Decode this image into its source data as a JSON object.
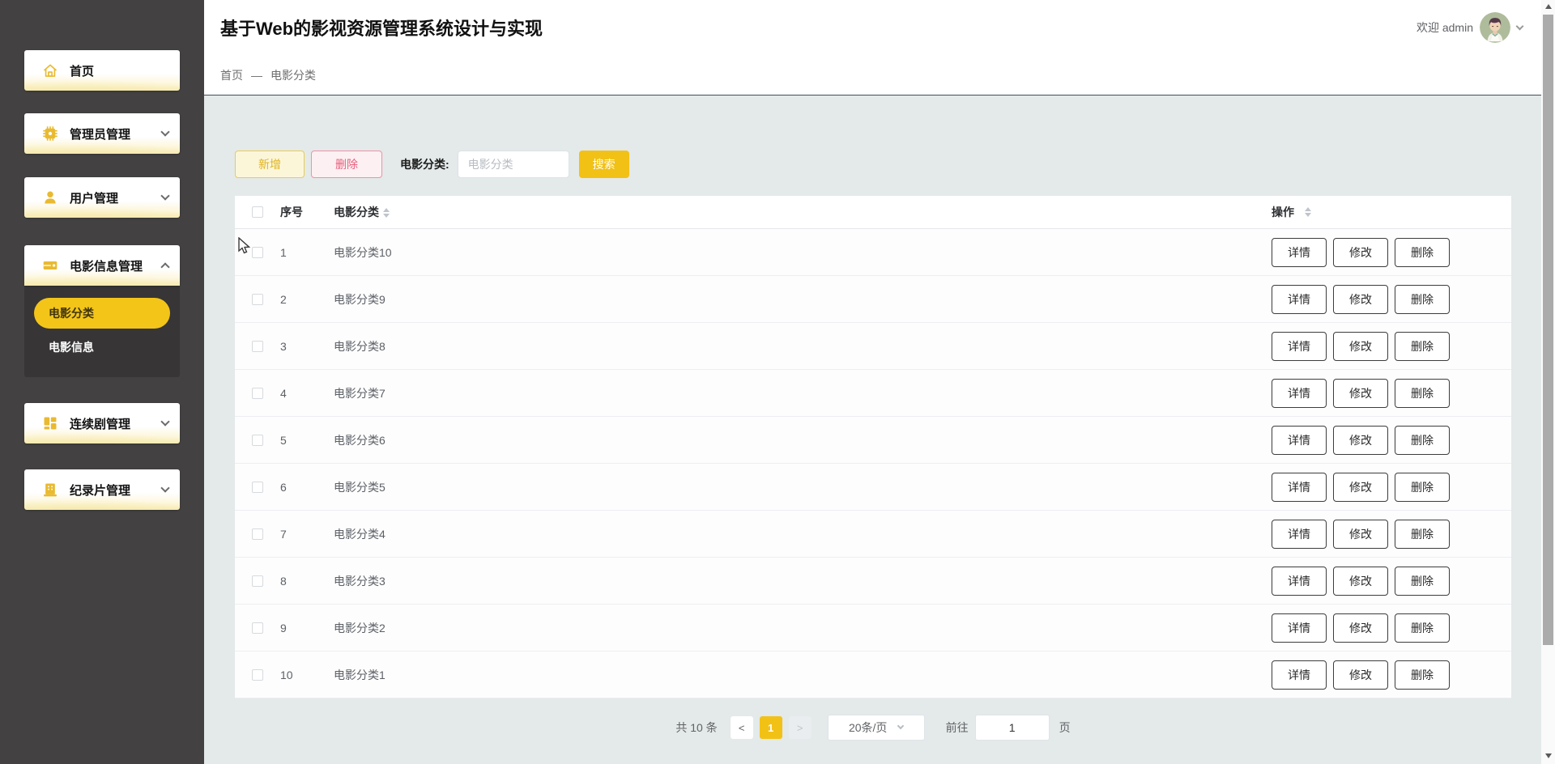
{
  "app": {
    "title": "基于Web的影视资源管理系统设计与实现",
    "welcome": "欢迎 admin"
  },
  "breadcrumb": {
    "home": "首页",
    "separator": "—",
    "current": "电影分类"
  },
  "sidebar": {
    "items": [
      {
        "label": "首页",
        "icon": "home-icon",
        "expandable": false
      },
      {
        "label": "管理员管理",
        "icon": "admin-icon",
        "expandable": true
      },
      {
        "label": "用户管理",
        "icon": "user-icon",
        "expandable": true
      },
      {
        "label": "电影信息管理",
        "icon": "movie-icon",
        "expandable": true,
        "expanded": true
      },
      {
        "label": "连续剧管理",
        "icon": "series-icon",
        "expandable": true
      },
      {
        "label": "纪录片管理",
        "icon": "documentary-icon",
        "expandable": true
      }
    ],
    "movie_children": [
      {
        "label": "电影分类",
        "active": true
      },
      {
        "label": "电影信息",
        "active": false
      }
    ]
  },
  "toolbar": {
    "add_label": "新增",
    "delete_label": "删除",
    "search_label": "电影分类:",
    "search_placeholder": "电影分类",
    "search_button": "搜索"
  },
  "table": {
    "columns": {
      "index": "序号",
      "category": "电影分类",
      "actions": "操作"
    },
    "action_labels": {
      "detail": "详情",
      "edit": "修改",
      "delete": "删除"
    },
    "rows": [
      {
        "index": "1",
        "category": "电影分类10"
      },
      {
        "index": "2",
        "category": "电影分类9"
      },
      {
        "index": "3",
        "category": "电影分类8"
      },
      {
        "index": "4",
        "category": "电影分类7"
      },
      {
        "index": "5",
        "category": "电影分类6"
      },
      {
        "index": "6",
        "category": "电影分类5"
      },
      {
        "index": "7",
        "category": "电影分类4"
      },
      {
        "index": "8",
        "category": "电影分类3"
      },
      {
        "index": "9",
        "category": "电影分类2"
      },
      {
        "index": "10",
        "category": "电影分类1"
      }
    ]
  },
  "pagination": {
    "total": "共 10 条",
    "prev": "<",
    "page": "1",
    "next": ">",
    "page_size": "20条/页",
    "goto_label": "前往",
    "goto_value": "1",
    "goto_suffix": "页"
  },
  "colors": {
    "accent_yellow": "#f2c116",
    "sidebar_bg": "#434141",
    "submenu_bg": "#373535",
    "content_bg": "#e4e9e9",
    "add_button_text": "#dfb31f",
    "delete_button_text": "#e75f7d",
    "table_text": "#5c6066"
  }
}
